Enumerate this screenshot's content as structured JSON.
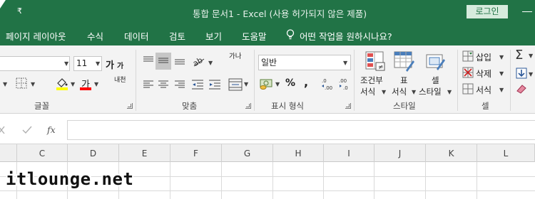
{
  "window": {
    "title": "통합 문서1  -  Excel (사용 허가되지 않은 제품)",
    "login_button": "로그인",
    "qat_chevron": "₹"
  },
  "menu": {
    "items": [
      "페이지 레이아웃",
      "수식",
      "데이터",
      "검토",
      "보기",
      "도움말"
    ],
    "tell_me": "어떤 작업을 원하시나요?"
  },
  "font_group": {
    "font_size": "11",
    "grow_font_glyph": "가",
    "shrink_font_glyph": "가",
    "font_color_glyph": "가",
    "phonetic_glyph": "내천",
    "label": "글꼴",
    "fill_color": "#ffff00",
    "font_color": "#ff0000"
  },
  "alignment_group": {
    "wrap_glyph": "가나",
    "label": "맞춤"
  },
  "number_group": {
    "format": "일반",
    "percent": "%",
    "comma": ",",
    "label": "표시 형식"
  },
  "styles_group": {
    "conditional": [
      "조건부",
      "서식"
    ],
    "table": [
      "표",
      "서식"
    ],
    "cell_styles": [
      "셀",
      "스타일"
    ],
    "label": "스타일"
  },
  "cells_group": {
    "insert": "삽입",
    "delete": "삭제",
    "format": "서식",
    "label": "셀"
  },
  "editing_group": {
    "sum_glyph": "Σ"
  },
  "formula_bar": {
    "fx": "fx",
    "value": ""
  },
  "columns": [
    "C",
    "D",
    "E",
    "F",
    "G",
    "H",
    "I",
    "J",
    "K",
    "L"
  ],
  "watermark": "itlounge.net"
}
